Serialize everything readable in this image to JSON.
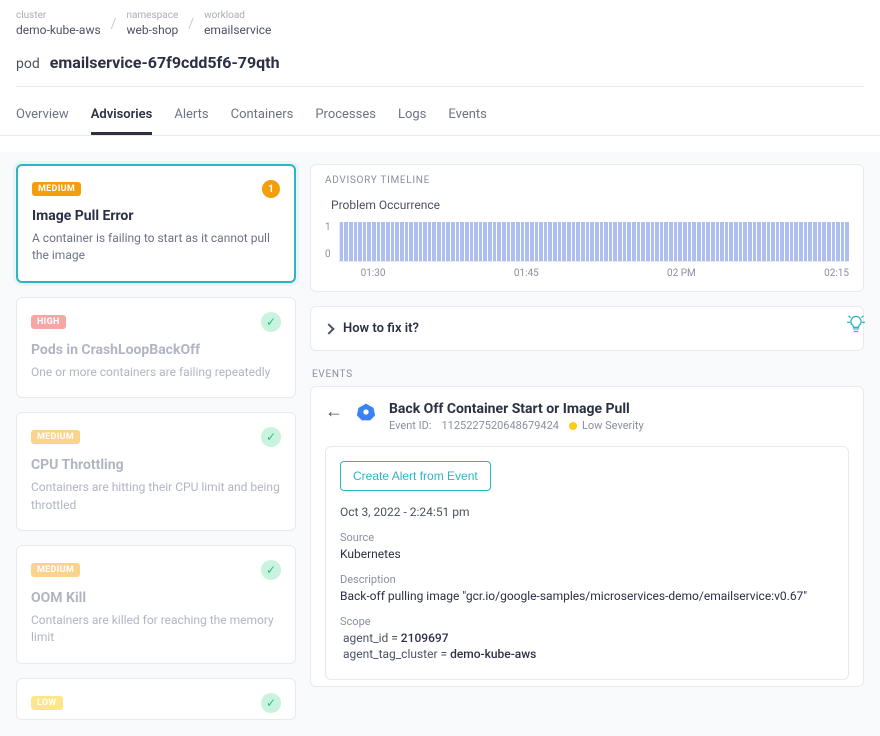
{
  "breadcrumb": {
    "cluster_label": "cluster",
    "cluster": "demo-kube-aws",
    "namespace_label": "namespace",
    "namespace": "web-shop",
    "workload_label": "workload",
    "workload": "emailservice"
  },
  "pod": {
    "prefix": "pod",
    "name": "emailservice-67f9cdd5f6-79qth"
  },
  "tabs": {
    "overview": "Overview",
    "advisories": "Advisories",
    "alerts": "Alerts",
    "containers": "Containers",
    "processes": "Processes",
    "logs": "Logs",
    "events": "Events"
  },
  "advisories": [
    {
      "severity": "MEDIUM",
      "count": "1",
      "title": "Image Pull Error",
      "desc": "A container is failing to start as it cannot pull the image",
      "selected": true
    },
    {
      "severity": "HIGH",
      "title": "Pods in CrashLoopBackOff",
      "desc": "One or more containers are failing repeatedly",
      "resolved": true
    },
    {
      "severity": "MEDIUM",
      "title": "CPU Throttling",
      "desc": "Containers are hitting their CPU limit and being throttled",
      "resolved": true
    },
    {
      "severity": "MEDIUM",
      "title": "OOM Kill",
      "desc": "Containers are killed for reaching the memory limit",
      "resolved": true
    },
    {
      "severity": "LOW",
      "title": "",
      "desc": "",
      "resolved": true
    }
  ],
  "timeline": {
    "header": "ADVISORY TIMELINE",
    "chart_title": "Problem Occurrence",
    "y_top": "1",
    "y_bot": "0",
    "x": [
      "01:30",
      "01:45",
      "02 PM",
      "02:15"
    ]
  },
  "fix": {
    "label": "How to fix it?"
  },
  "events_header": "EVENTS",
  "event": {
    "title": "Back Off Container Start or Image Pull",
    "eid_label": "Event ID:",
    "eid": "1125227520648679424",
    "severity": "Low Severity",
    "btn": "Create Alert from Event",
    "timestamp": "Oct 3, 2022 - 2:24:51 pm",
    "source_k": "Source",
    "source_v": "Kubernetes",
    "desc_k": "Description",
    "desc_v": "Back-off pulling image \"gcr.io/google-samples/microservices-demo/emailservice:v0.67\"",
    "scope_k": "Scope",
    "scope": [
      {
        "key": "agent_id",
        "val": "2109697"
      },
      {
        "key": "agent_tag_cluster",
        "val": "demo-kube-aws"
      }
    ]
  },
  "chart_data": {
    "type": "bar",
    "title": "Problem Occurrence",
    "ylim": [
      0,
      1
    ],
    "x_ticks": [
      "01:30",
      "01:45",
      "02 PM",
      "02:15"
    ],
    "series": [
      {
        "name": "occurrence",
        "value": 1,
        "note": "constant value 1 across the visible time range (~01:30 to ~02:20)"
      }
    ]
  }
}
